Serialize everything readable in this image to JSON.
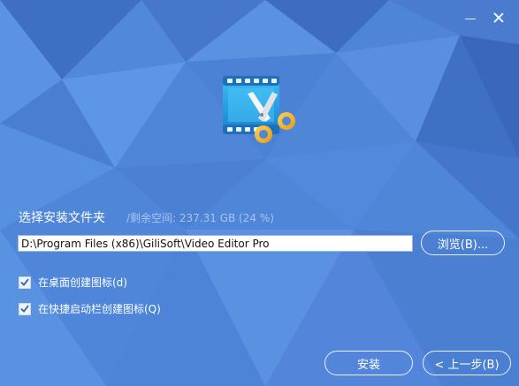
{
  "window": {
    "minimize_label": "—",
    "close_label": "✕"
  },
  "app_icon": {
    "name": "video-editor-scissors-icon"
  },
  "install_folder": {
    "label": "选择安装文件夹",
    "free_space": "/剩余空间: 237.31 GB (24 %)",
    "path_value": "D:\\Program Files (x86)\\GiliSoft\\Video Editor Pro"
  },
  "buttons": {
    "browse": "浏览(B)...",
    "install": "安装",
    "back": "< 上一步(B)"
  },
  "options": {
    "desktop_icon": {
      "label": "在桌面创建图标(d)",
      "checked": true
    },
    "quicklaunch_icon": {
      "label": "在快捷启动栏创建图标(Q)",
      "checked": true
    }
  },
  "colors": {
    "background": "#4a7fd4",
    "button_border": "#e8f0ff",
    "free_space_text": "#a9c5ef"
  }
}
